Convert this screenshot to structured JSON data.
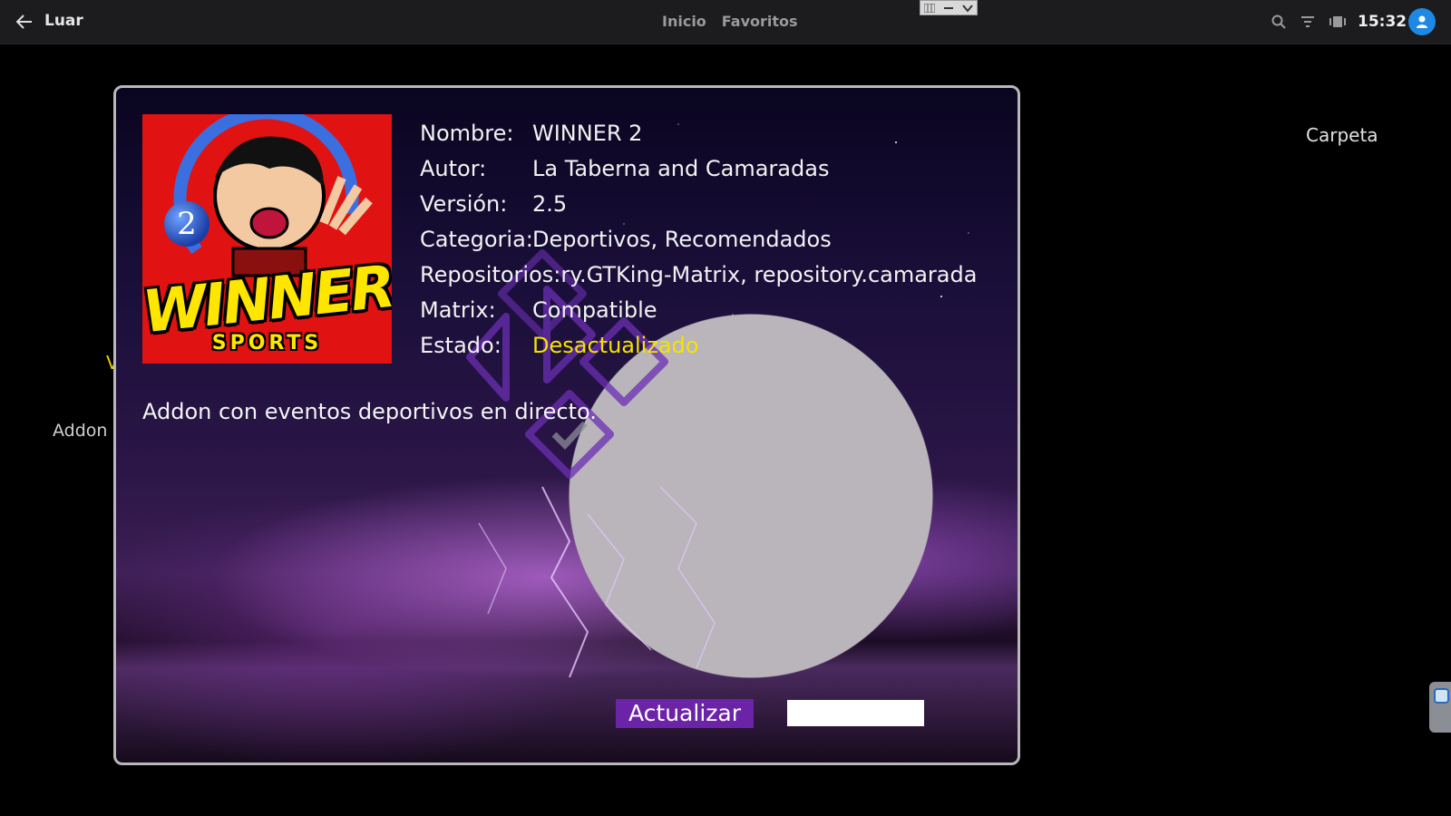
{
  "topbar": {
    "title": "Luar",
    "nav": [
      "Inicio",
      "Favoritos"
    ],
    "clock": "15:32"
  },
  "background": {
    "folder_label": "Carpeta",
    "addon_label": "Addon",
    "partial_mark": "V"
  },
  "dialog": {
    "logo": {
      "title": "WINNER",
      "subtitle": "SPORTS",
      "badge": "2"
    },
    "fields": [
      {
        "key": "Nombre:",
        "value": "WINNER 2"
      },
      {
        "key": "Autor:",
        "value": "La Taberna and Camaradas"
      },
      {
        "key": "Versión:",
        "value": "2.5"
      },
      {
        "key": "Categoria:",
        "value": "Deportivos, Recomendados"
      },
      {
        "key": "Repositorios:",
        "value": "ry.GTKing-Matrix, repository.camarada"
      },
      {
        "key": "Matrix:",
        "value": "Compatible"
      },
      {
        "key": "Estado:",
        "value": "Desactualizado"
      }
    ],
    "description": "Addon con eventos deportivos en directo.",
    "update_button": "Actualizar",
    "secondary_button": ""
  },
  "colors": {
    "accent_purple": "#6b23a8",
    "status_yellow": "#f4e400",
    "avatar_blue": "#1e88e5"
  },
  "icons": [
    "back-arrow-icon",
    "search-icon",
    "filter-icon",
    "layout-icon",
    "user-icon",
    "kodi-logo-icon"
  ]
}
